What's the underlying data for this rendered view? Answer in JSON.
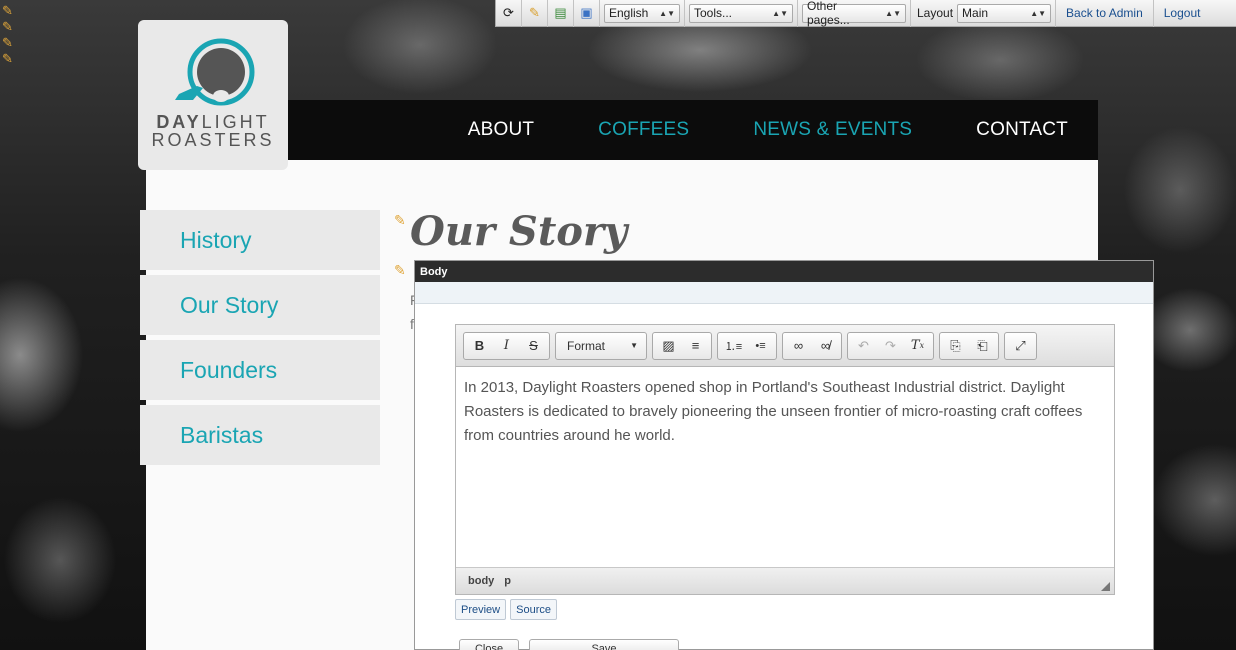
{
  "admin_bar": {
    "language": "English",
    "tools": "Tools...",
    "other_pages": "Other pages...",
    "layout_label": "Layout",
    "layout_value": "Main",
    "back_to_admin": "Back to Admin",
    "logout": "Logout"
  },
  "logo": {
    "line1_bold": "DAY",
    "line1_rest": "LIGHT",
    "line2": "ROASTERS"
  },
  "nav": {
    "items": [
      {
        "label": "ABOUT",
        "color": "#ffffff"
      },
      {
        "label": "COFFEES",
        "color": "#1aa5b3"
      },
      {
        "label": "NEWS & EVENTS",
        "color": "#1aa5b3"
      },
      {
        "label": "CONTACT",
        "color": "#ffffff"
      }
    ]
  },
  "sidebar": {
    "items": [
      "History",
      "Our Story",
      "Founders",
      "Baristas"
    ]
  },
  "page": {
    "title": "Our Story",
    "bg_line1": "F",
    "bg_line2": "f"
  },
  "dialog": {
    "title": "Body",
    "toolbar": {
      "format_label": "Format"
    },
    "content": "In 2013, Daylight Roasters opened shop in Portland's Southeast Industrial district. Daylight Roasters is dedicated to bravely pioneering the unseen frontier of micro-roasting craft coffees from countries around he world.",
    "status_path": [
      "body",
      "p"
    ],
    "preview_label": "Preview",
    "source_label": "Source",
    "close_label": "Close",
    "save_label": "Save"
  },
  "colors": {
    "accent": "#1aa5b3",
    "nav_bg": "#0c0c0c"
  }
}
